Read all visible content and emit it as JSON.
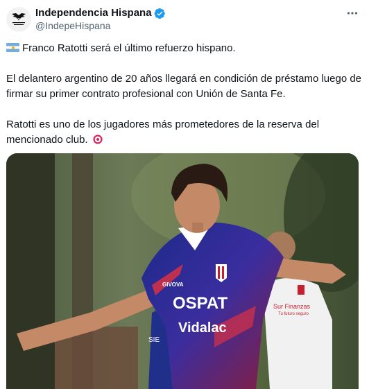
{
  "author": {
    "display_name": "Independencia Hispana",
    "handle": "@IndepeHispana",
    "avatar_text": "INDEPENDENCIA\nHISPANA"
  },
  "tweet": {
    "paragraphs": [
      "Franco Ratotti será el último refuerzo hispano.",
      "El delantero argentino de 20 años llegará en condición de préstamo luego de firmar su primer contrato profesional con Unión de Santa Fe.",
      "Ratotti es uno de los jugadores más prometedores de la reserva del mencionado club."
    ]
  },
  "media": {
    "shirt_text": {
      "sponsor_main": "OSPAT",
      "sponsor_secondary": "Vidalac",
      "brand": "GIVOVA",
      "sleeve": "Sur Finanzas",
      "sleeve_small": "Tu futuro seguro",
      "other_sleeve": "SIE"
    }
  },
  "icons": {
    "flag": "argentina-flag-icon",
    "target": "direct-hit-icon",
    "verified": "verified-badge-icon",
    "more": "more-options-icon"
  },
  "colors": {
    "verified": "#1d9bf0",
    "text": "#0f1419",
    "muted": "#536471"
  }
}
